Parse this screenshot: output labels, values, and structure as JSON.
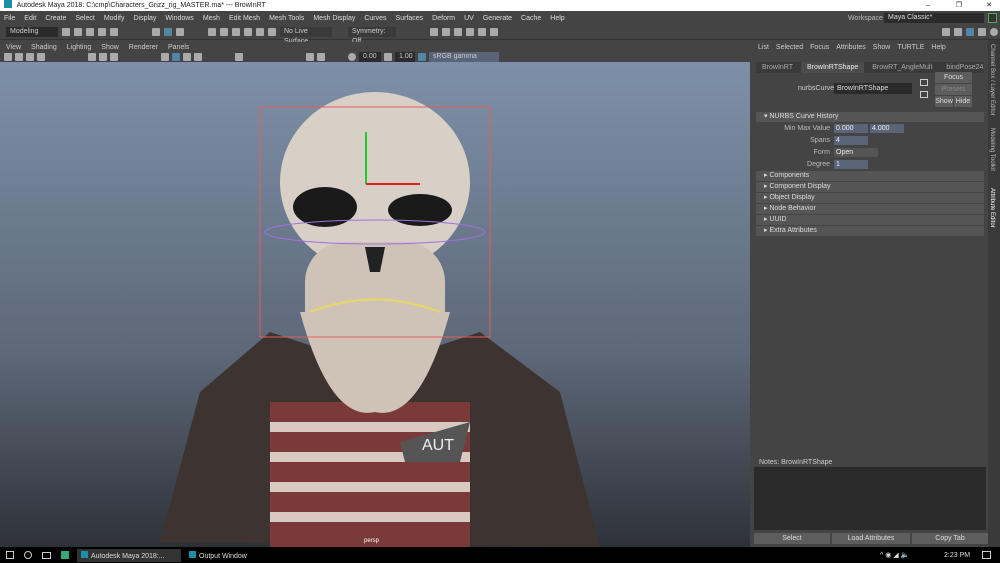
{
  "window": {
    "title": "Autodesk Maya 2018: C:\\cmp\\Characters_Grizz_rig_MASTER.ma*  ---  BrowInRT",
    "min": "–",
    "max": "❐",
    "close": "✕"
  },
  "menu": [
    "File",
    "Edit",
    "Create",
    "Select",
    "Modify",
    "Display",
    "Windows",
    "Mesh",
    "Edit Mesh",
    "Mesh Tools",
    "Mesh Display",
    "Curves",
    "Surfaces",
    "Deform",
    "UV",
    "Generate",
    "Cache",
    "Help"
  ],
  "workspace": {
    "label": "Workspace :",
    "value": "Maya Classic*"
  },
  "shelf": {
    "mode": "Modeling",
    "live_surface": "No Live Surface",
    "symmetry": "Symmetry: Off"
  },
  "viewport": {
    "menu": [
      "View",
      "Shading",
      "Lighting",
      "Show",
      "Renderer",
      "Panels"
    ],
    "exposure": "0.00",
    "gamma": "1.00",
    "colorspace": "sRGB gamma",
    "camera": "persp",
    "decal_text": "AUT"
  },
  "attr_editor": {
    "menu": [
      "List",
      "Selected",
      "Focus",
      "Attributes",
      "Show",
      "TURTLE",
      "Help"
    ],
    "tabs": [
      "BrowInRT",
      "BrowInRTShape",
      "BrowRT_AngleMult",
      "bindPose24"
    ],
    "active_tab": 1,
    "node_label": "nurbsCurve:",
    "node_value": "BrowInRTShape",
    "buttons": {
      "focus": "Focus",
      "presets": "Presets",
      "show": "Show",
      "hide": "Hide"
    },
    "history": {
      "title": "NURBS Curve History",
      "min_max_label": "Min Max Value",
      "min": "0.000",
      "max": "4.000",
      "spans_label": "Spans",
      "spans": "4",
      "form_label": "Form",
      "form": "Open",
      "degree_label": "Degree",
      "degree": "1"
    },
    "sections": [
      "Components",
      "Component Display",
      "Object Display",
      "Node Behavior",
      "UUID",
      "Extra Attributes"
    ],
    "notes_label": "Notes:  BrowInRTShape",
    "bottom": [
      "Select",
      "Load Attributes",
      "Copy Tab"
    ]
  },
  "side_tabs": [
    "Channel Box / Layer Editor",
    "Modeling Toolkit",
    "Attribute Editor"
  ],
  "taskbar": {
    "items": [
      "Autodesk Maya 2018:...",
      "Output Window"
    ],
    "time": "2:23 PM"
  }
}
